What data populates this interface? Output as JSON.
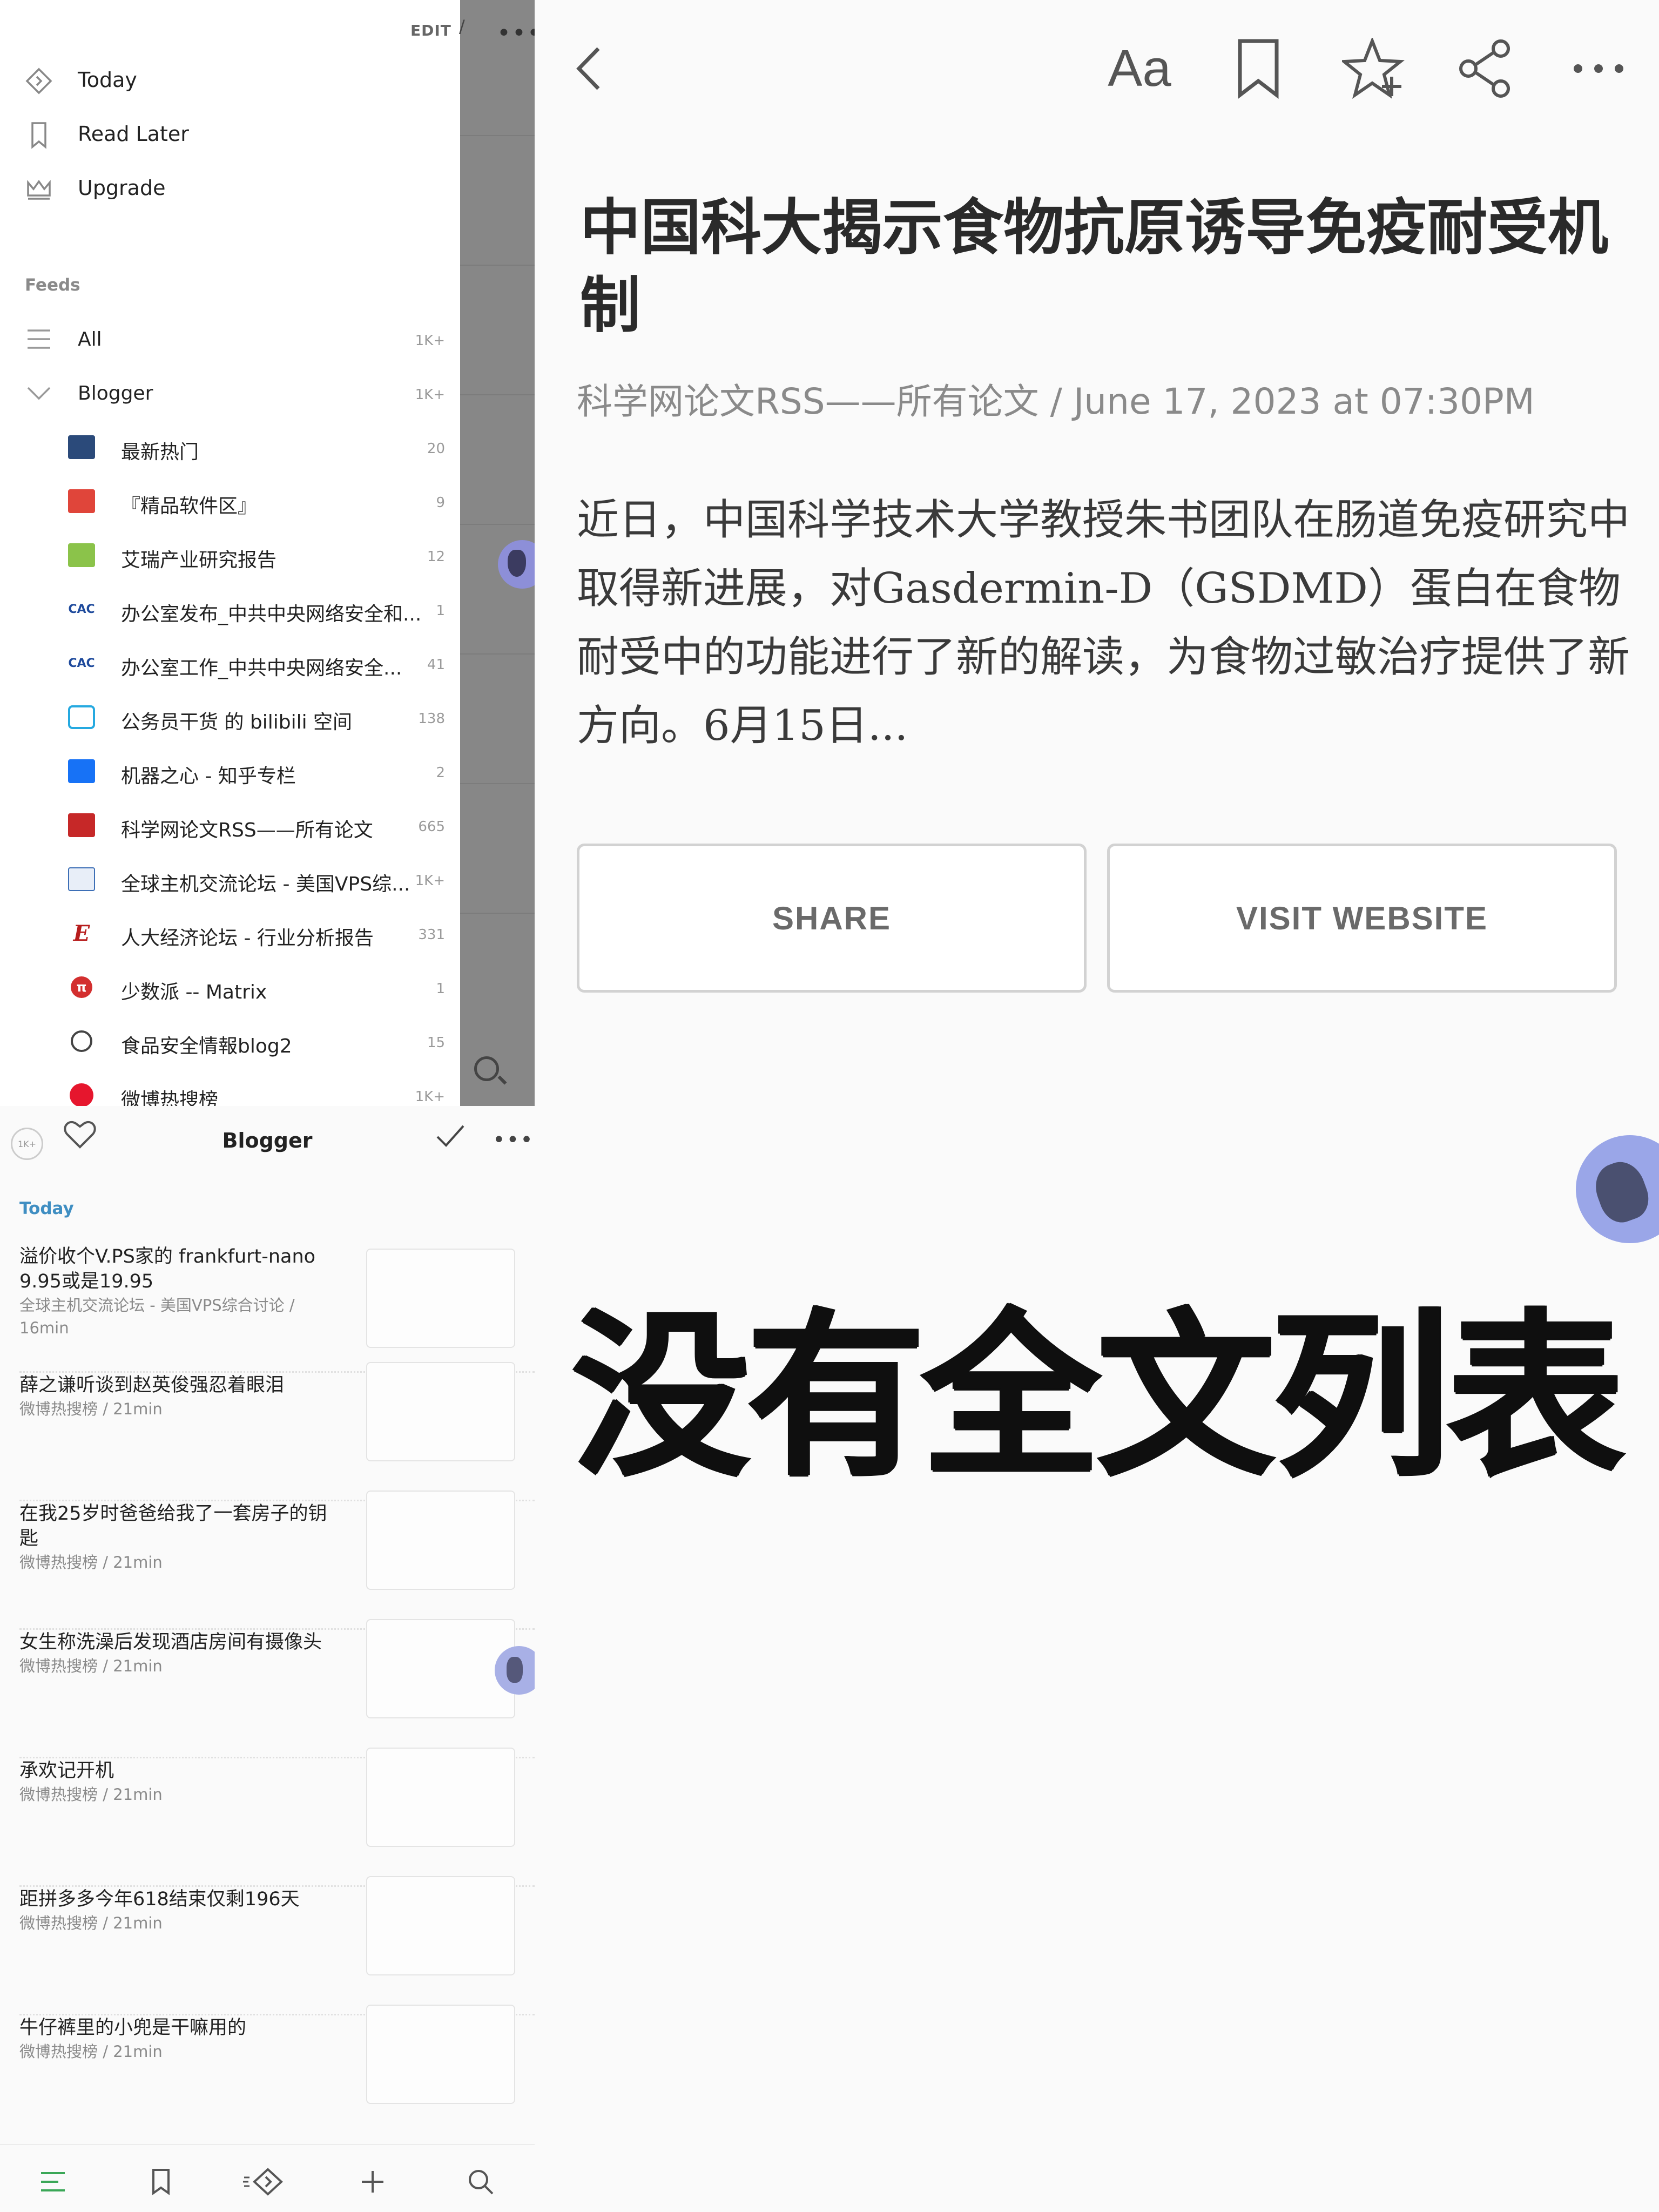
{
  "sidebar": {
    "edit_label": "EDIT",
    "nav": [
      {
        "label": "Today",
        "icon": "today-icon"
      },
      {
        "label": "Read Later",
        "icon": "bookmark-icon"
      },
      {
        "label": "Upgrade",
        "icon": "crown-icon"
      }
    ],
    "feeds_heading": "Feeds",
    "feeds": [
      {
        "label": "All",
        "count": "1K+",
        "icon": "list-icon"
      },
      {
        "label": "Blogger",
        "count": "1K+",
        "icon": "chevron-down-icon"
      },
      {
        "label": "最新热门",
        "count": "20",
        "icon": "feed-icon",
        "color": "#2b4a7a"
      },
      {
        "label": "『精品软件区』",
        "count": "9",
        "icon": "feed-icon",
        "color": "#e0453a"
      },
      {
        "label": "艾瑞产业研究报告",
        "count": "12",
        "icon": "feed-icon",
        "color": "#8bc34a"
      },
      {
        "label": "办公室发布_中共中央网络安全和...",
        "count": "1",
        "icon": "feed-icon",
        "color": "#1e4a9c"
      },
      {
        "label": "办公室工作_中共中央网络安全...",
        "count": "41",
        "icon": "feed-icon",
        "color": "#1e4a9c"
      },
      {
        "label": "公务员干货 的 bilibili 空间",
        "count": "138",
        "icon": "feed-icon",
        "color": "#25a9e0"
      },
      {
        "label": "机器之心 - 知乎专栏",
        "count": "2",
        "icon": "feed-icon",
        "color": "#1772f6"
      },
      {
        "label": "科学网论文RSS——所有论文",
        "count": "665",
        "icon": "feed-icon",
        "color": "#c62828"
      },
      {
        "label": "全球主机交流论坛 - 美国VPS综...",
        "count": "1K+",
        "icon": "feed-icon",
        "color": "#3d6fb6"
      },
      {
        "label": "人大经济论坛 - 行业分析报告",
        "count": "331",
        "icon": "feed-icon",
        "color": "#b71c1c"
      },
      {
        "label": "少数派 -- Matrix",
        "count": "1",
        "icon": "feed-icon",
        "color": "#d32f2f"
      },
      {
        "label": "食品安全情報blog2",
        "count": "15",
        "icon": "feed-icon",
        "color": "#444444"
      },
      {
        "label": "微博热搜榜",
        "count": "1K+",
        "icon": "feed-icon",
        "color": "#e6162d"
      }
    ]
  },
  "article": {
    "title": "中国科大揭示食物抗原诱导免疫耐受机制",
    "meta": "科学网论文RSS——所有论文 / June 17, 2023 at 07:30PM",
    "body": "近日，中国科学技术大学教授朱书团队在肠道免疫研究中取得新进展，对Gasdermin-D（GSDMD）蛋白在食物耐受中的功能进行了新的解读，为食物过敏治疗提供了新方向。6月15日...",
    "font_label": "Aa",
    "share_label": "SHARE",
    "visit_label": "VISIT WEBSITE"
  },
  "list": {
    "badge": "1K+",
    "title": "Blogger",
    "section": "Today",
    "items": [
      {
        "title": "溢价收个V.PS家的 frankfurt-nano 9.95或是19.95",
        "meta": "全球主机交流论坛 - 美国VPS综合讨论 / 16min"
      },
      {
        "title": "薛之谦听谈到赵英俊强忍着眼泪",
        "meta": "微博热搜榜 / 21min"
      },
      {
        "title": "在我25岁时爸爸给我了一套房子的钥匙",
        "meta": "微博热搜榜 / 21min"
      },
      {
        "title": "女生称洗澡后发现酒店房间有摄像头",
        "meta": "微博热搜榜 / 21min"
      },
      {
        "title": "承欢记开机",
        "meta": "微博热搜榜 / 21min"
      },
      {
        "title": "距拼多多今年618结束仅剩196天",
        "meta": "微博热搜榜 / 21min"
      },
      {
        "title": "牛仔裤里的小兜是干嘛用的",
        "meta": "微博热搜榜 / 21min"
      }
    ],
    "tabs": [
      {
        "icon": "feeds-list-icon",
        "glyph": "☰"
      },
      {
        "icon": "bookmark-icon",
        "glyph": "⌑"
      },
      {
        "icon": "today-icon",
        "glyph": "◈"
      },
      {
        "icon": "add-icon",
        "glyph": "+"
      },
      {
        "icon": "search-icon",
        "glyph": "⌕"
      }
    ]
  },
  "caption": "没有全文列表",
  "colors": {
    "accent": "#3f8ec2",
    "tab_active": "#3aa757"
  }
}
